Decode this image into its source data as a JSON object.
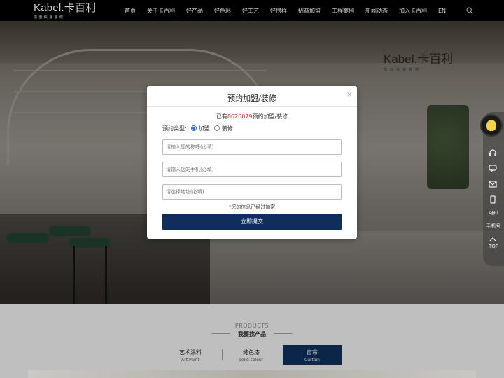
{
  "header": {
    "logo_text": "Kabel.卡百利",
    "logo_sub": "墙面快速装修",
    "nav": [
      "首页",
      "关于卡百利",
      "好产品",
      "好色彩",
      "好工艺",
      "好榜样",
      "招商加盟",
      "工程案例",
      "新闻动态",
      "加入卡百利",
      "EN"
    ]
  },
  "hero": {
    "brand_text": "Kabel.卡百利",
    "brand_sub": "墙面快速装修"
  },
  "side_tools": {
    "count_label": "400",
    "phone_label": "手机号",
    "top_label": "TOP",
    "icons": [
      "mascot-avatar",
      "headset-icon",
      "chat-icon",
      "mail-icon",
      "phone-icon",
      "chevron-up-icon"
    ]
  },
  "products": {
    "title_en": "PRODUCTS",
    "title_cn": "我要找产品",
    "tabs": [
      {
        "cn": "艺术涂料",
        "en": "Art Paint"
      },
      {
        "cn": "纯色漆",
        "en": "solid colour"
      },
      {
        "cn": "窗帘",
        "en": "Curtain"
      }
    ],
    "active_tab": 2
  },
  "modal": {
    "title": "预约加盟/装修",
    "close": "×",
    "count_prefix": "已有",
    "count": "8626079",
    "count_suffix": "预约加盟/装修",
    "type_label": "预约类型:",
    "options": [
      "加盟",
      "装修"
    ],
    "selected_option": "加盟",
    "fields": {
      "name_placeholder": "请输入您的称呼(必填)",
      "phone_placeholder": "请输入您的手机(必填)",
      "address_placeholder": "请选择地址(必填)"
    },
    "note": "*您的信息已经过加密",
    "submit": "立即提交"
  },
  "colors": {
    "brand_navy": "#0f2f5a",
    "count_red": "#d0241c",
    "radio_blue": "#2b6fd6"
  }
}
